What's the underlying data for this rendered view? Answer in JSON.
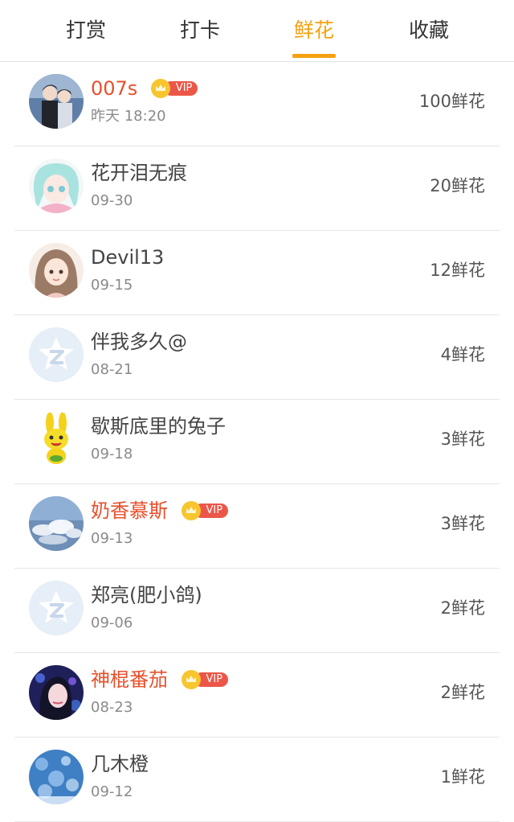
{
  "tabs": [
    {
      "label": "打赏",
      "active": false
    },
    {
      "label": "打卡",
      "active": false
    },
    {
      "label": "鲜花",
      "active": true
    },
    {
      "label": "收藏",
      "active": false
    }
  ],
  "colors": {
    "accent": "#f5a10f",
    "vip_name": "#e7502c",
    "vip_badge": "#ec5648",
    "crown": "#f7c62f"
  },
  "vip_badge_text": "VIP",
  "rows": [
    {
      "name": "007s",
      "vip": true,
      "date": "昨天 18:20",
      "amount": "100鲜花",
      "avatar": "couple-photo"
    },
    {
      "name": "花开泪无痕",
      "vip": false,
      "date": "09-30",
      "amount": "20鲜花",
      "avatar": "anime-girl-teal-hair"
    },
    {
      "name": "Devil13",
      "vip": false,
      "date": "09-15",
      "amount": "12鲜花",
      "avatar": "cartoon-girl-brown-hair"
    },
    {
      "name": "伴我多久@",
      "vip": false,
      "date": "08-21",
      "amount": "4鲜花",
      "avatar": "default-star-avatar"
    },
    {
      "name": "歇斯底里的兔子",
      "vip": false,
      "date": "09-18",
      "amount": "3鲜花",
      "avatar": "yellow-rabbit"
    },
    {
      "name": "奶香慕斯",
      "vip": true,
      "date": "09-13",
      "amount": "3鲜花",
      "avatar": "blue-sky-clouds"
    },
    {
      "name": "郑亮(肥小鸽)",
      "vip": false,
      "date": "09-06",
      "amount": "2鲜花",
      "avatar": "default-star-avatar"
    },
    {
      "name": "神棍番茄",
      "vip": true,
      "date": "08-23",
      "amount": "2鲜花",
      "avatar": "girl-blue-lights"
    },
    {
      "name": "几木橙",
      "vip": false,
      "date": "09-12",
      "amount": "1鲜花",
      "avatar": "blue-bokeh"
    }
  ]
}
